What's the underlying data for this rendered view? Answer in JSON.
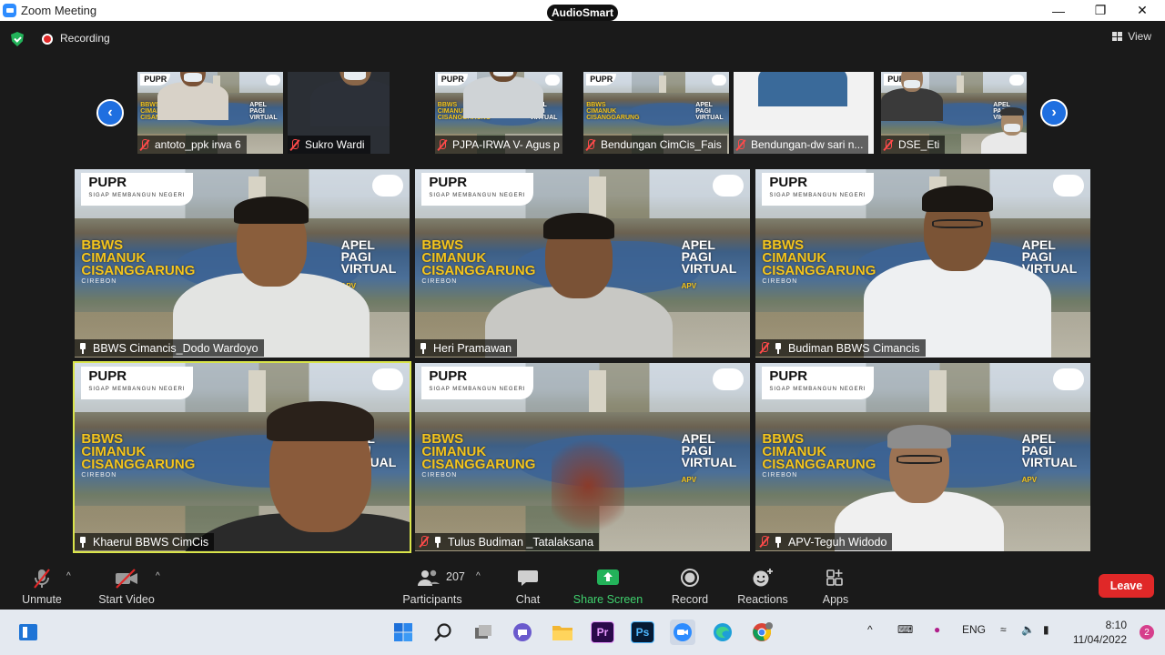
{
  "window": {
    "title": "Zoom Meeting",
    "audio_badge": "AudioSmart"
  },
  "meeting_status": {
    "recording_label": "Recording",
    "view_label": "View"
  },
  "thumbnails": [
    {
      "name": "antoto_ppk irwa 6"
    },
    {
      "name": "Sukro Wardi"
    },
    {
      "name": "PJPA-IRWA V-  Agus p"
    },
    {
      "name": "Bendungan CimCis_Fais"
    },
    {
      "name": "Bendungan-dw  sari n..."
    },
    {
      "name": "DSE_Eti"
    }
  ],
  "background_text": {
    "logo": "PUPR",
    "logo_sub": "SIGAP MEMBANGUN NEGERI",
    "org_line1": "BBWS",
    "org_line2": "CIMANUK",
    "org_line3": "CISANGGARUNG",
    "city": "CIREBON",
    "event_line1": "APEL",
    "event_line2": "PAGI",
    "event_line3": "VIRTUAL",
    "event_abbr": "APV"
  },
  "tiles": [
    {
      "name": "BBWS Cimancis_Dodo Wardoyo",
      "muted": false
    },
    {
      "name": "Heri Pramawan",
      "muted": false
    },
    {
      "name": "Budiman BBWS Cimancis",
      "muted": true
    },
    {
      "name": "Khaerul BBWS CimCis",
      "muted": false
    },
    {
      "name": "Tulus Budiman _Tatalaksana",
      "muted": true
    },
    {
      "name": "APV-Teguh Widodo",
      "muted": true
    }
  ],
  "toolbar": {
    "unmute": "Unmute",
    "start_video": "Start Video",
    "participants": "Participants",
    "participant_count": "207",
    "chat": "Chat",
    "share_screen": "Share Screen",
    "record": "Record",
    "reactions": "Reactions",
    "apps": "Apps",
    "leave": "Leave"
  },
  "taskbar": {
    "language": "ENG",
    "time": "8:10",
    "date": "11/04/2022",
    "notification_count": "2",
    "premiere_label": "Pr",
    "photoshop_label": "Ps"
  },
  "colors": {
    "accent_blue": "#2d8cff",
    "leave_red": "#e02828",
    "share_green": "#23b35a",
    "active_speaker": "#d9e44a"
  }
}
